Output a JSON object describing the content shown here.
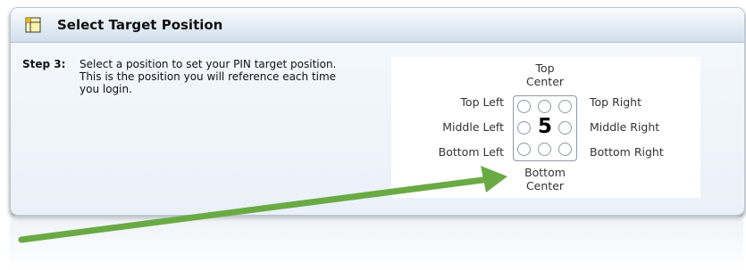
{
  "panel": {
    "title": "Select Target Position"
  },
  "step": {
    "label": "Step 3:",
    "text": "Select a position to set your PIN target position. This is the position you will reference each time you login."
  },
  "positions": {
    "top_center": "Top\nCenter",
    "top_left": "Top Left",
    "top_right": "Top Right",
    "middle_left": "Middle Left",
    "middle_right": "Middle Right",
    "bottom_left": "Bottom Left",
    "bottom_right": "Bottom Right",
    "bottom_center": "Bottom\nCenter",
    "selected_center_number": "5"
  },
  "annotation": {
    "arrow_color": "#6aaa45"
  },
  "colors": {
    "panel_border": "#b9c6d3",
    "title_gradient_bottom": "#d2dfec"
  }
}
